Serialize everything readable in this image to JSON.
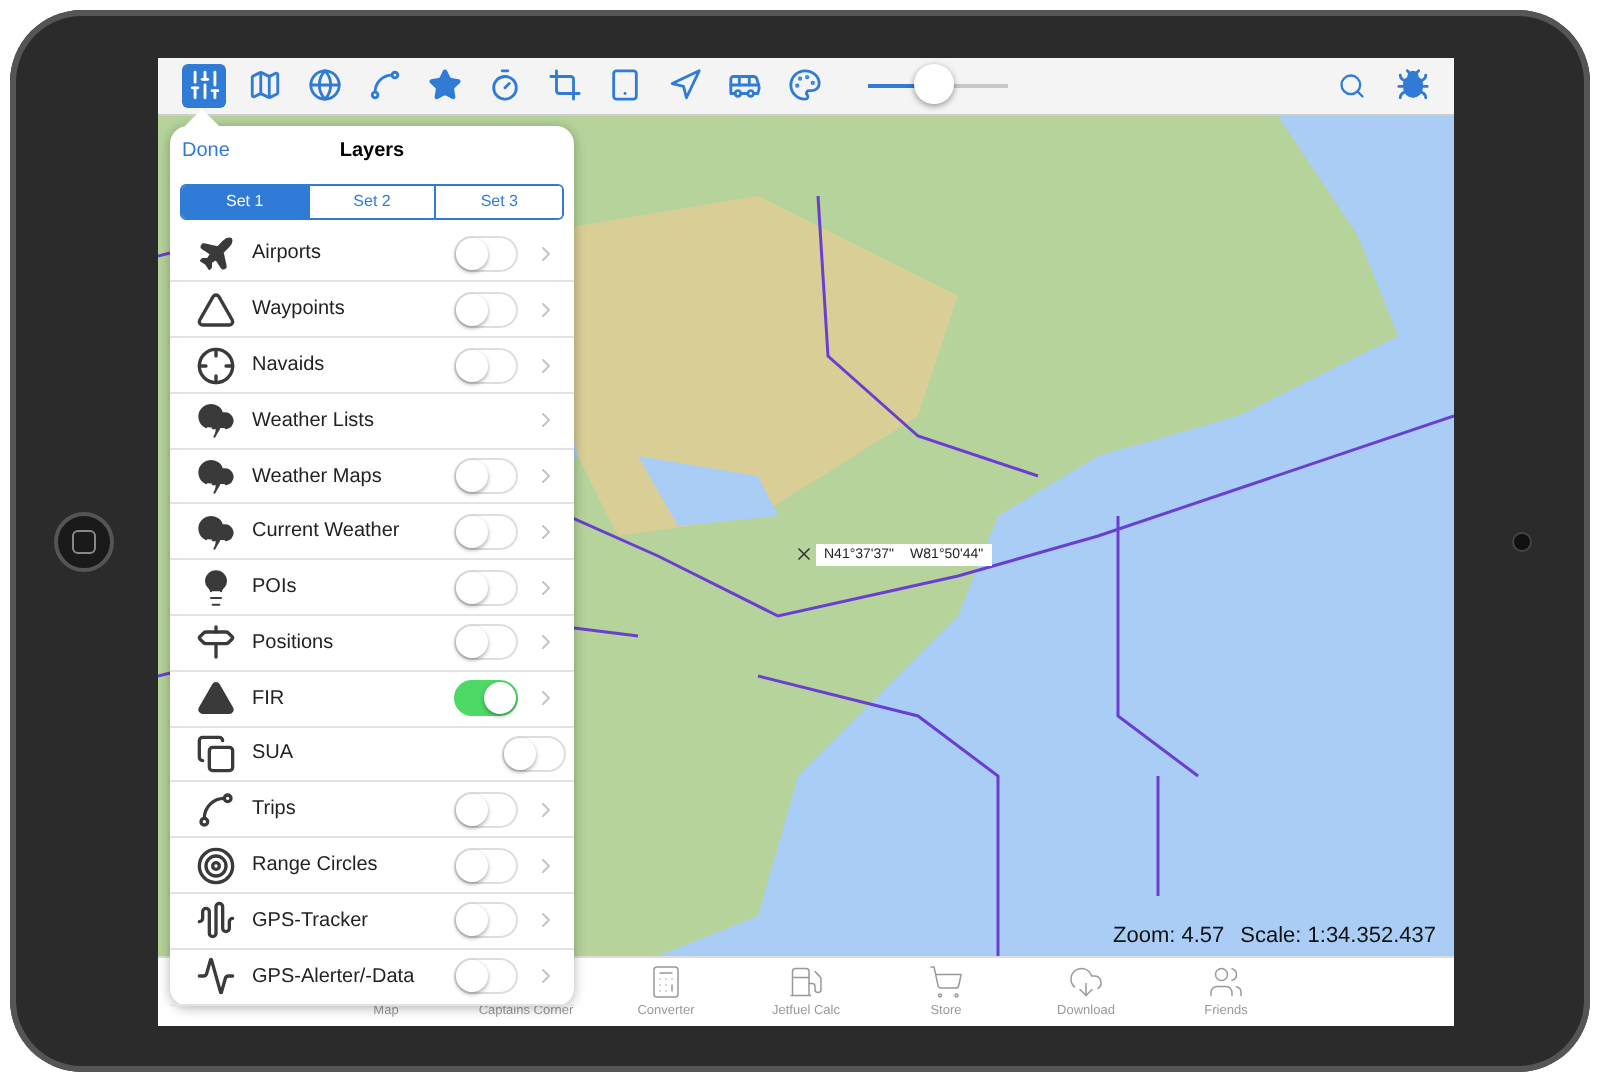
{
  "toolbar": {
    "slider": {
      "level": 0.47
    }
  },
  "layers_panel": {
    "done": "Done",
    "title": "Layers",
    "sets": [
      {
        "label": "Set 1",
        "selected": true
      },
      {
        "label": "Set 2",
        "selected": false
      },
      {
        "label": "Set 3",
        "selected": false
      }
    ],
    "layers": [
      {
        "label": "Airports",
        "kind": "toggle-detail",
        "on": false
      },
      {
        "label": "Waypoints",
        "kind": "toggle-detail",
        "on": false
      },
      {
        "label": "Navaids",
        "kind": "toggle-detail",
        "on": false
      },
      {
        "label": "Weather Lists",
        "kind": "detail"
      },
      {
        "label": "Weather Maps",
        "kind": "toggle-detail",
        "on": false
      },
      {
        "label": "Current Weather",
        "kind": "toggle-detail",
        "on": false
      },
      {
        "label": "POIs",
        "kind": "toggle-detail",
        "on": false
      },
      {
        "label": "Positions",
        "kind": "toggle-detail",
        "on": false
      },
      {
        "label": "FIR",
        "kind": "toggle-detail",
        "on": true
      },
      {
        "label": "SUA",
        "kind": "toggle",
        "on": false
      },
      {
        "label": "Trips",
        "kind": "toggle-detail",
        "on": false
      },
      {
        "label": "Range Circles",
        "kind": "toggle-detail",
        "on": false
      },
      {
        "label": "GPS-Tracker",
        "kind": "toggle-detail",
        "on": false
      },
      {
        "label": "GPS-Alerter/-Data",
        "kind": "toggle-detail",
        "on": false
      }
    ]
  },
  "map": {
    "position": {
      "latitude": "N41°37'37\"",
      "longitude": "W81°50'44\""
    },
    "zoom": "Zoom: 4.57",
    "scale": "Scale: 1:34.352.437"
  },
  "tab_bar": [
    {
      "label": "Map"
    },
    {
      "label": "Captains Corner"
    },
    {
      "label": "Converter"
    },
    {
      "label": "Jetfuel Calc"
    },
    {
      "label": "Store"
    },
    {
      "label": "Download"
    },
    {
      "label": "Friends"
    }
  ]
}
